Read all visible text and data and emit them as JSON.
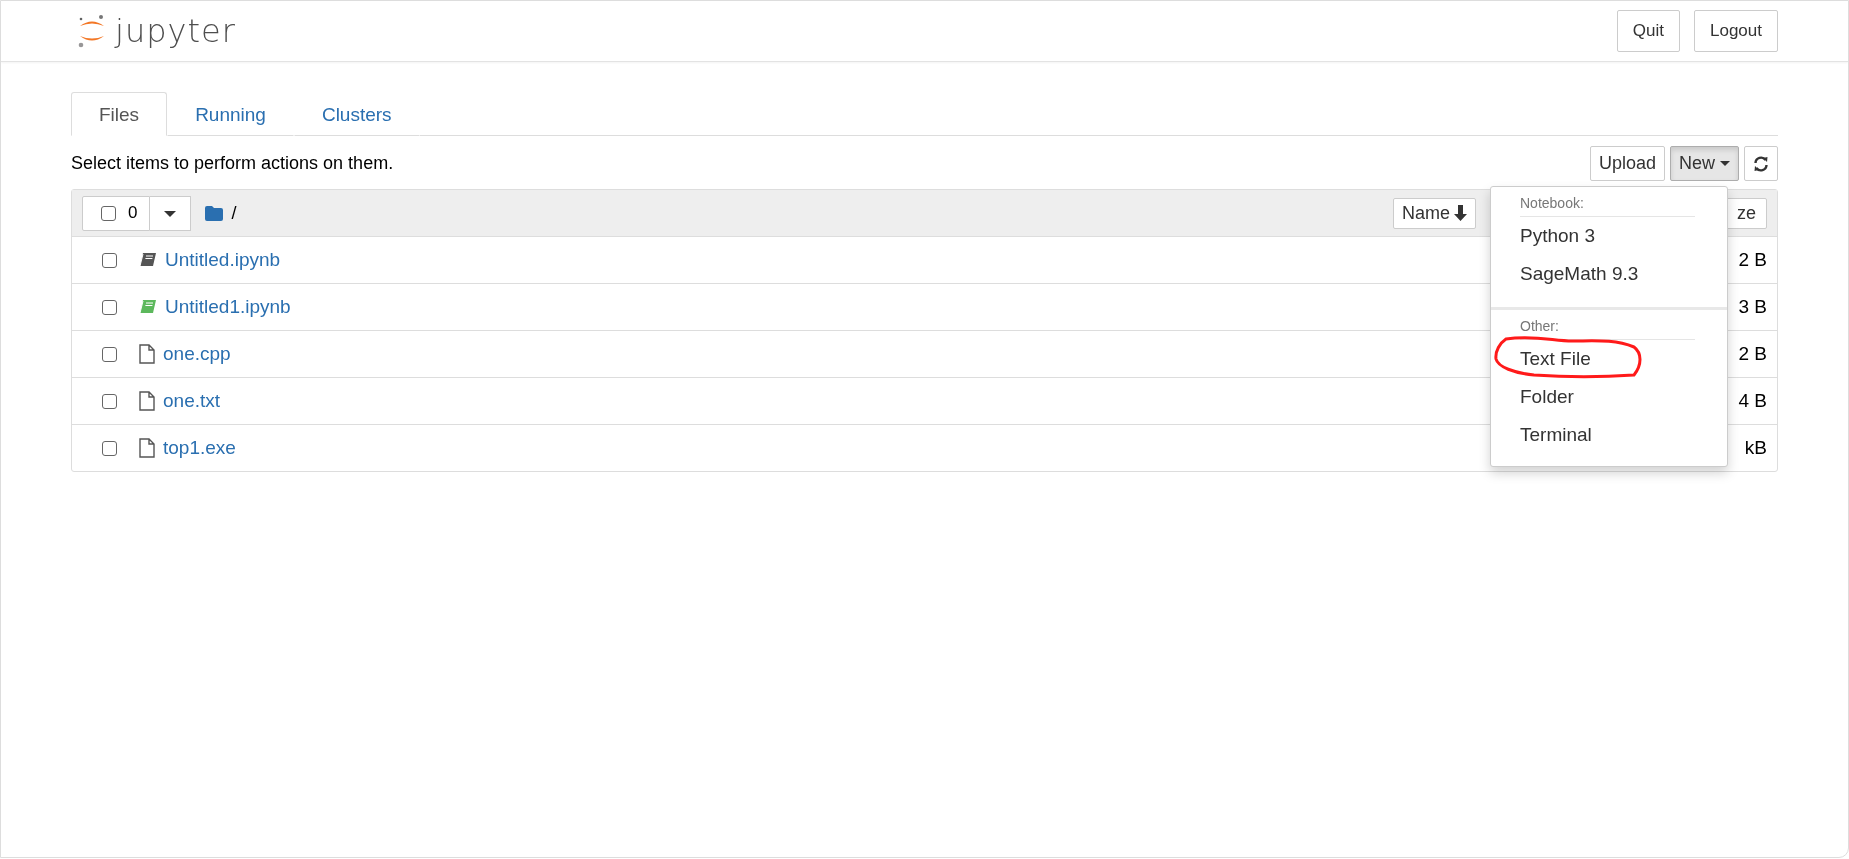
{
  "header": {
    "logo_text": "jupyter",
    "buttons": [
      "Quit",
      "Logout"
    ]
  },
  "tabs": [
    {
      "label": "Files",
      "selected": true
    },
    {
      "label": "Running",
      "selected": false
    },
    {
      "label": "Clusters",
      "selected": false
    }
  ],
  "hint": "Select items to perform actions on them.",
  "toolbar": {
    "upload": "Upload",
    "new": "New",
    "new_open": true
  },
  "new_menu": [
    {
      "heading": "Notebook:",
      "items": [
        {
          "label": "Python 3",
          "circled": false
        },
        {
          "label": "SageMath 9.3",
          "circled": false
        }
      ]
    },
    {
      "heading": "Other:",
      "items": [
        {
          "label": "Text File",
          "circled": true
        },
        {
          "label": "Folder",
          "circled": false
        },
        {
          "label": "Terminal",
          "circled": false
        }
      ]
    }
  ],
  "list_header": {
    "select_all_checked": false,
    "count": "0",
    "path": "/",
    "columns": [
      "Name",
      "ze"
    ]
  },
  "files": [
    {
      "name": "Untitled.ipynb",
      "kind": "notebook",
      "running": false,
      "checked": false,
      "size": "2 B"
    },
    {
      "name": "Untitled1.ipynb",
      "kind": "notebook",
      "running": true,
      "checked": false,
      "size": "3 B"
    },
    {
      "name": "one.cpp",
      "kind": "file",
      "checked": false,
      "size": "2 B"
    },
    {
      "name": "one.txt",
      "kind": "file",
      "checked": false,
      "size": "4 B"
    },
    {
      "name": "top1.exe",
      "kind": "file",
      "checked": false,
      "size": "kB"
    }
  ]
}
